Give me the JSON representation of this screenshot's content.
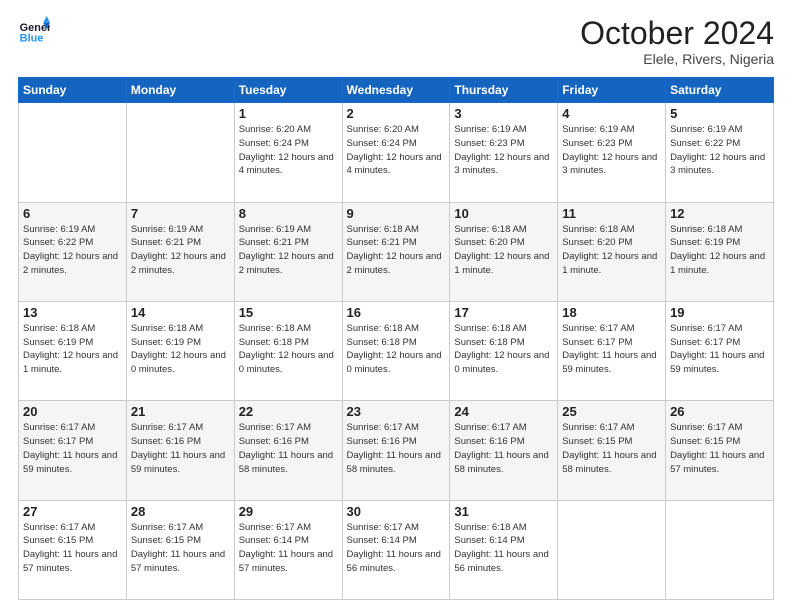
{
  "header": {
    "logo_line1": "General",
    "logo_line2": "Blue",
    "month": "October 2024",
    "location": "Elele, Rivers, Nigeria"
  },
  "weekdays": [
    "Sunday",
    "Monday",
    "Tuesday",
    "Wednesday",
    "Thursday",
    "Friday",
    "Saturday"
  ],
  "weeks": [
    [
      {
        "day": "",
        "info": ""
      },
      {
        "day": "",
        "info": ""
      },
      {
        "day": "1",
        "info": "Sunrise: 6:20 AM\nSunset: 6:24 PM\nDaylight: 12 hours and 4 minutes."
      },
      {
        "day": "2",
        "info": "Sunrise: 6:20 AM\nSunset: 6:24 PM\nDaylight: 12 hours and 4 minutes."
      },
      {
        "day": "3",
        "info": "Sunrise: 6:19 AM\nSunset: 6:23 PM\nDaylight: 12 hours and 3 minutes."
      },
      {
        "day": "4",
        "info": "Sunrise: 6:19 AM\nSunset: 6:23 PM\nDaylight: 12 hours and 3 minutes."
      },
      {
        "day": "5",
        "info": "Sunrise: 6:19 AM\nSunset: 6:22 PM\nDaylight: 12 hours and 3 minutes."
      }
    ],
    [
      {
        "day": "6",
        "info": "Sunrise: 6:19 AM\nSunset: 6:22 PM\nDaylight: 12 hours and 2 minutes."
      },
      {
        "day": "7",
        "info": "Sunrise: 6:19 AM\nSunset: 6:21 PM\nDaylight: 12 hours and 2 minutes."
      },
      {
        "day": "8",
        "info": "Sunrise: 6:19 AM\nSunset: 6:21 PM\nDaylight: 12 hours and 2 minutes."
      },
      {
        "day": "9",
        "info": "Sunrise: 6:18 AM\nSunset: 6:21 PM\nDaylight: 12 hours and 2 minutes."
      },
      {
        "day": "10",
        "info": "Sunrise: 6:18 AM\nSunset: 6:20 PM\nDaylight: 12 hours and 1 minute."
      },
      {
        "day": "11",
        "info": "Sunrise: 6:18 AM\nSunset: 6:20 PM\nDaylight: 12 hours and 1 minute."
      },
      {
        "day": "12",
        "info": "Sunrise: 6:18 AM\nSunset: 6:19 PM\nDaylight: 12 hours and 1 minute."
      }
    ],
    [
      {
        "day": "13",
        "info": "Sunrise: 6:18 AM\nSunset: 6:19 PM\nDaylight: 12 hours and 1 minute."
      },
      {
        "day": "14",
        "info": "Sunrise: 6:18 AM\nSunset: 6:19 PM\nDaylight: 12 hours and 0 minutes."
      },
      {
        "day": "15",
        "info": "Sunrise: 6:18 AM\nSunset: 6:18 PM\nDaylight: 12 hours and 0 minutes."
      },
      {
        "day": "16",
        "info": "Sunrise: 6:18 AM\nSunset: 6:18 PM\nDaylight: 12 hours and 0 minutes."
      },
      {
        "day": "17",
        "info": "Sunrise: 6:18 AM\nSunset: 6:18 PM\nDaylight: 12 hours and 0 minutes."
      },
      {
        "day": "18",
        "info": "Sunrise: 6:17 AM\nSunset: 6:17 PM\nDaylight: 11 hours and 59 minutes."
      },
      {
        "day": "19",
        "info": "Sunrise: 6:17 AM\nSunset: 6:17 PM\nDaylight: 11 hours and 59 minutes."
      }
    ],
    [
      {
        "day": "20",
        "info": "Sunrise: 6:17 AM\nSunset: 6:17 PM\nDaylight: 11 hours and 59 minutes."
      },
      {
        "day": "21",
        "info": "Sunrise: 6:17 AM\nSunset: 6:16 PM\nDaylight: 11 hours and 59 minutes."
      },
      {
        "day": "22",
        "info": "Sunrise: 6:17 AM\nSunset: 6:16 PM\nDaylight: 11 hours and 58 minutes."
      },
      {
        "day": "23",
        "info": "Sunrise: 6:17 AM\nSunset: 6:16 PM\nDaylight: 11 hours and 58 minutes."
      },
      {
        "day": "24",
        "info": "Sunrise: 6:17 AM\nSunset: 6:16 PM\nDaylight: 11 hours and 58 minutes."
      },
      {
        "day": "25",
        "info": "Sunrise: 6:17 AM\nSunset: 6:15 PM\nDaylight: 11 hours and 58 minutes."
      },
      {
        "day": "26",
        "info": "Sunrise: 6:17 AM\nSunset: 6:15 PM\nDaylight: 11 hours and 57 minutes."
      }
    ],
    [
      {
        "day": "27",
        "info": "Sunrise: 6:17 AM\nSunset: 6:15 PM\nDaylight: 11 hours and 57 minutes."
      },
      {
        "day": "28",
        "info": "Sunrise: 6:17 AM\nSunset: 6:15 PM\nDaylight: 11 hours and 57 minutes."
      },
      {
        "day": "29",
        "info": "Sunrise: 6:17 AM\nSunset: 6:14 PM\nDaylight: 11 hours and 57 minutes."
      },
      {
        "day": "30",
        "info": "Sunrise: 6:17 AM\nSunset: 6:14 PM\nDaylight: 11 hours and 56 minutes."
      },
      {
        "day": "31",
        "info": "Sunrise: 6:18 AM\nSunset: 6:14 PM\nDaylight: 11 hours and 56 minutes."
      },
      {
        "day": "",
        "info": ""
      },
      {
        "day": "",
        "info": ""
      }
    ]
  ]
}
